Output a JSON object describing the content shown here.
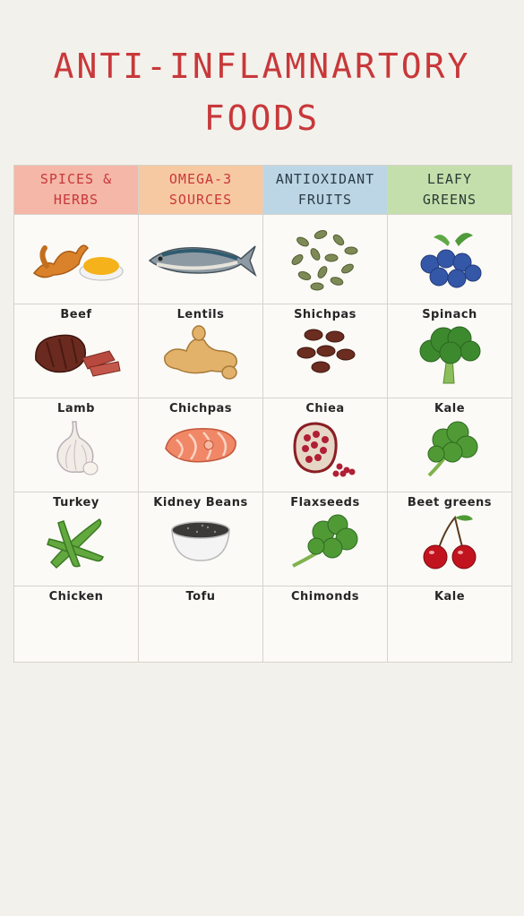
{
  "title": {
    "line1": "ANTI-INFLAMNARTORY",
    "line2": "FOODS"
  },
  "columns": [
    {
      "line1": "SPICES &",
      "line2": "HERBS",
      "bg": "#f4b7a8",
      "color": "#c8383a"
    },
    {
      "line1": "OMEGA-3",
      "line2": "SOURCES",
      "bg": "#f7c9a2",
      "color": "#c8383a"
    },
    {
      "line1": "ANTIOXIDANT",
      "line2": "FRUITS",
      "bg": "#bcd6e5",
      "color": "#2b3b48"
    },
    {
      "line1": "LEAFY",
      "line2": "GREENS",
      "bg": "#c5dfac",
      "color": "#2b3b36"
    }
  ],
  "rows": [
    {
      "labels": [
        "Beef",
        "Lentils",
        "Shichpas",
        "Spinach"
      ]
    },
    {
      "labels": [
        "Lamb",
        "Chichpas",
        "Chiea",
        "Kale"
      ]
    },
    {
      "labels": [
        "Turkey",
        "Kidney Beans",
        "Flaxseeds",
        "Beet greens"
      ]
    },
    {
      "labels": [
        "Chicken",
        "Tofu",
        "Chimonds",
        "Kale"
      ]
    }
  ],
  "icons": {
    "row0": [
      "turmeric-icon",
      "mackerel-icon",
      "pumpkin-seeds-icon",
      "blueberries-icon"
    ],
    "row1": [
      "beef-steak-icon",
      "ginger-icon",
      "beans-icon",
      "broccoli-icon"
    ],
    "row2": [
      "garlic-icon",
      "salmon-icon",
      "pomegranate-icon",
      "kale-icon"
    ],
    "row3": [
      "edamame-icon",
      "chia-bowl-icon",
      "kale-icon",
      "cherries-icon"
    ]
  }
}
